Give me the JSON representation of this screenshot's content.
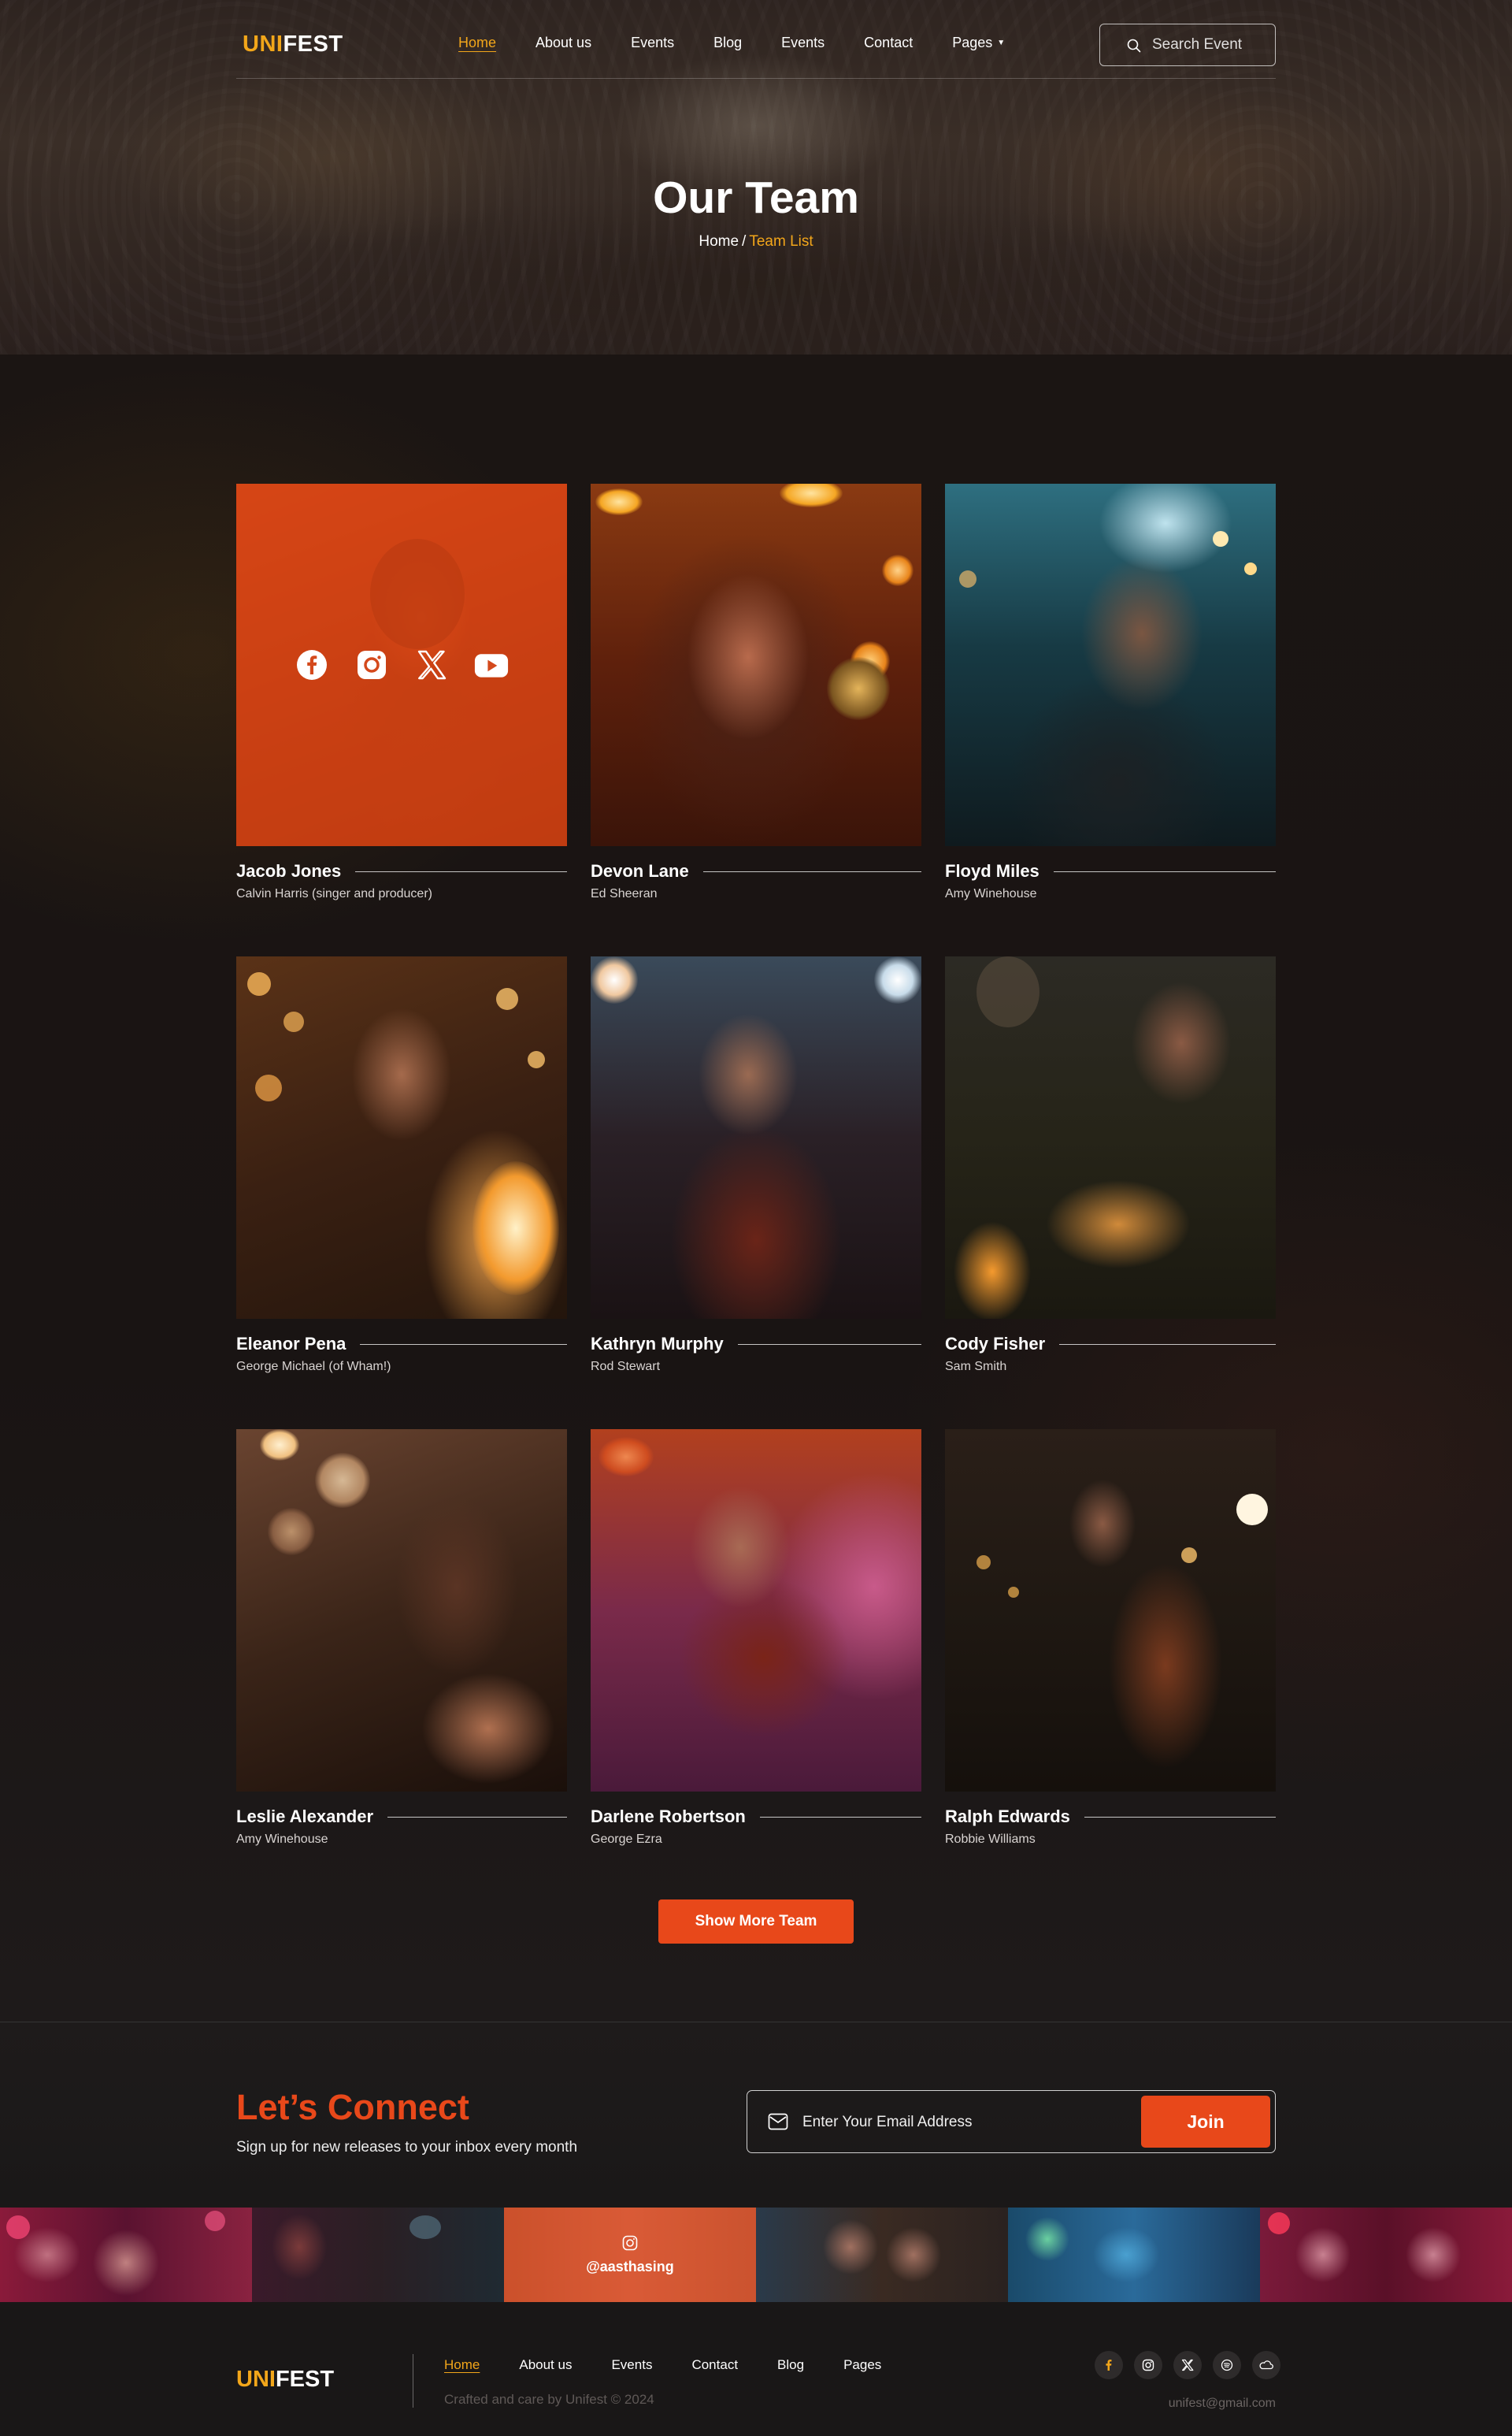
{
  "brand": {
    "logo_part1": "UNI",
    "logo_part2": "FEST"
  },
  "nav": {
    "links": [
      "Home",
      "About us",
      "Events",
      "Blog",
      "Events",
      "Contact",
      "Pages"
    ],
    "search_placeholder": "Search Event"
  },
  "hero": {
    "title": "Our Team",
    "breadcrumb_home": "Home",
    "breadcrumb_sep": "/",
    "breadcrumb_current": "Team List"
  },
  "team": {
    "members": [
      {
        "name": "Jacob Jones",
        "role": "Calvin Harris (singer and producer)"
      },
      {
        "name": "Devon Lane",
        "role": "Ed Sheeran"
      },
      {
        "name": "Floyd Miles",
        "role": "Amy Winehouse"
      },
      {
        "name": "Eleanor Pena",
        "role": "George Michael (of Wham!)"
      },
      {
        "name": "Kathryn Murphy",
        "role": "Rod Stewart"
      },
      {
        "name": "Cody Fisher",
        "role": "Sam Smith"
      },
      {
        "name": "Leslie Alexander",
        "role": "Amy Winehouse"
      },
      {
        "name": "Darlene Robertson",
        "role": "George Ezra"
      },
      {
        "name": "Ralph Edwards",
        "role": "Robbie Williams"
      }
    ],
    "hover_social_icons": [
      "facebook-icon",
      "instagram-icon",
      "x-icon",
      "youtube-icon"
    ],
    "show_more_label": "Show More Team"
  },
  "connect": {
    "title": "Let’s Connect",
    "subtitle": "Sign up for new releases to your inbox every month",
    "email_placeholder": "Enter Your Email Address",
    "join_label": "Join"
  },
  "gallery": {
    "handle": "@aasthasing"
  },
  "footer": {
    "links": [
      "Home",
      "About us",
      "Events",
      "Contact",
      "Blog",
      "Pages"
    ],
    "copyright": "Crafted and care by Unifest © 2024",
    "email": "unifest@gmail.com",
    "social_icons": [
      "facebook-icon",
      "instagram-icon",
      "x-icon",
      "spotify-icon",
      "soundcloud-icon"
    ]
  },
  "colors": {
    "accent_orange": "#e8481a",
    "accent_yellow": "#f2a61a",
    "background": "#171414"
  }
}
